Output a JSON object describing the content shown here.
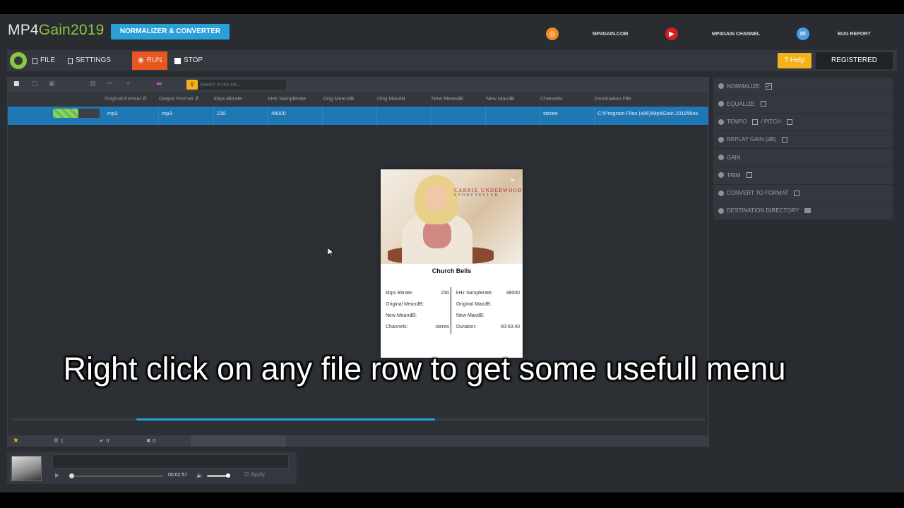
{
  "header": {
    "app_name_a": "MP4",
    "app_name_b": "Gain2019",
    "badge": "NORMALIZER & CONVERTER",
    "links": [
      {
        "label": "MP4GAIN.COM",
        "icon": "globe-icon",
        "color": "#f08a24"
      },
      {
        "label": "MP4GAIN CHANNEL",
        "icon": "youtube-icon",
        "color": "#d32121"
      },
      {
        "label": "BUG REPORT",
        "icon": "mail-icon",
        "color": "#4a9fe0"
      }
    ]
  },
  "toolbar": {
    "file": "FILE",
    "settings": "SETTINGS",
    "run": "RUN",
    "stop": "STOP",
    "help": "? Help",
    "registered": "REGISTERED",
    "run_color": "#e9561f",
    "help_color": "#f3b21b"
  },
  "list": {
    "search_placeholder": "Search in the list...",
    "columns": [
      "Original Format",
      "Output Format",
      "kbps Bitrate",
      "kHz Samplerate",
      "Orig MeandB",
      "Orig MaxdB",
      "New MeandB",
      "New MaxdB",
      "Channels",
      "Destination File"
    ],
    "rows": [
      {
        "progress": 0.55,
        "original_format": "mp3",
        "output_format": "mp3",
        "bitrate": "230",
        "samplerate": "48000",
        "orig_meandb": "",
        "orig_maxdb": "",
        "new_meandb": "",
        "new_maxdb": "",
        "channels": "stereo",
        "destination": "C:\\Program Files (x86)\\Mp4Gain 2019\\files"
      }
    ],
    "scroll_position": 0.18,
    "scroll_thumb": 0.43
  },
  "popup": {
    "cover_artist": "CARRIE UNDERWOOD",
    "cover_album": "STORYTELLER",
    "close": "×",
    "title": "Church Bells",
    "left": [
      {
        "label": "kbps Bitrate:",
        "value": "230"
      },
      {
        "label": "Original MeandB:",
        "value": ""
      },
      {
        "label": "New MeandB:",
        "value": ""
      },
      {
        "label": "Channels:",
        "value": "stereo"
      }
    ],
    "right": [
      {
        "label": "kHz Samplerate:",
        "value": "48000"
      },
      {
        "label": "Original MaxdB:",
        "value": ""
      },
      {
        "label": "New MaxdB:",
        "value": ""
      },
      {
        "label": "Duration:",
        "value": "00:03:40"
      }
    ]
  },
  "status": {
    "files": "1",
    "ok": "0",
    "errors": "0"
  },
  "player": {
    "time": "00:02:57",
    "apply": "Apply",
    "seek_position": 0.0,
    "volume": 1.0
  },
  "options": [
    {
      "label": "NORMALIZE",
      "checkbox": "checked"
    },
    {
      "label": "EQUALIZE",
      "checkbox": "empty"
    },
    {
      "label": "TEMPO",
      "label2": "/ PITCH",
      "checkbox": "double"
    },
    {
      "label": "REPLAY GAIN (dB)",
      "checkbox": "empty"
    },
    {
      "label": "GAIN",
      "checkbox": "none"
    },
    {
      "label": "TRIM",
      "checkbox": "empty"
    },
    {
      "label": "CONVERT TO FORMAT",
      "checkbox": "empty"
    },
    {
      "label": "DESTINATION DIRECTORY",
      "checkbox": "folder"
    }
  ],
  "subtitle": "Right click on any file row to get some usefull menu"
}
